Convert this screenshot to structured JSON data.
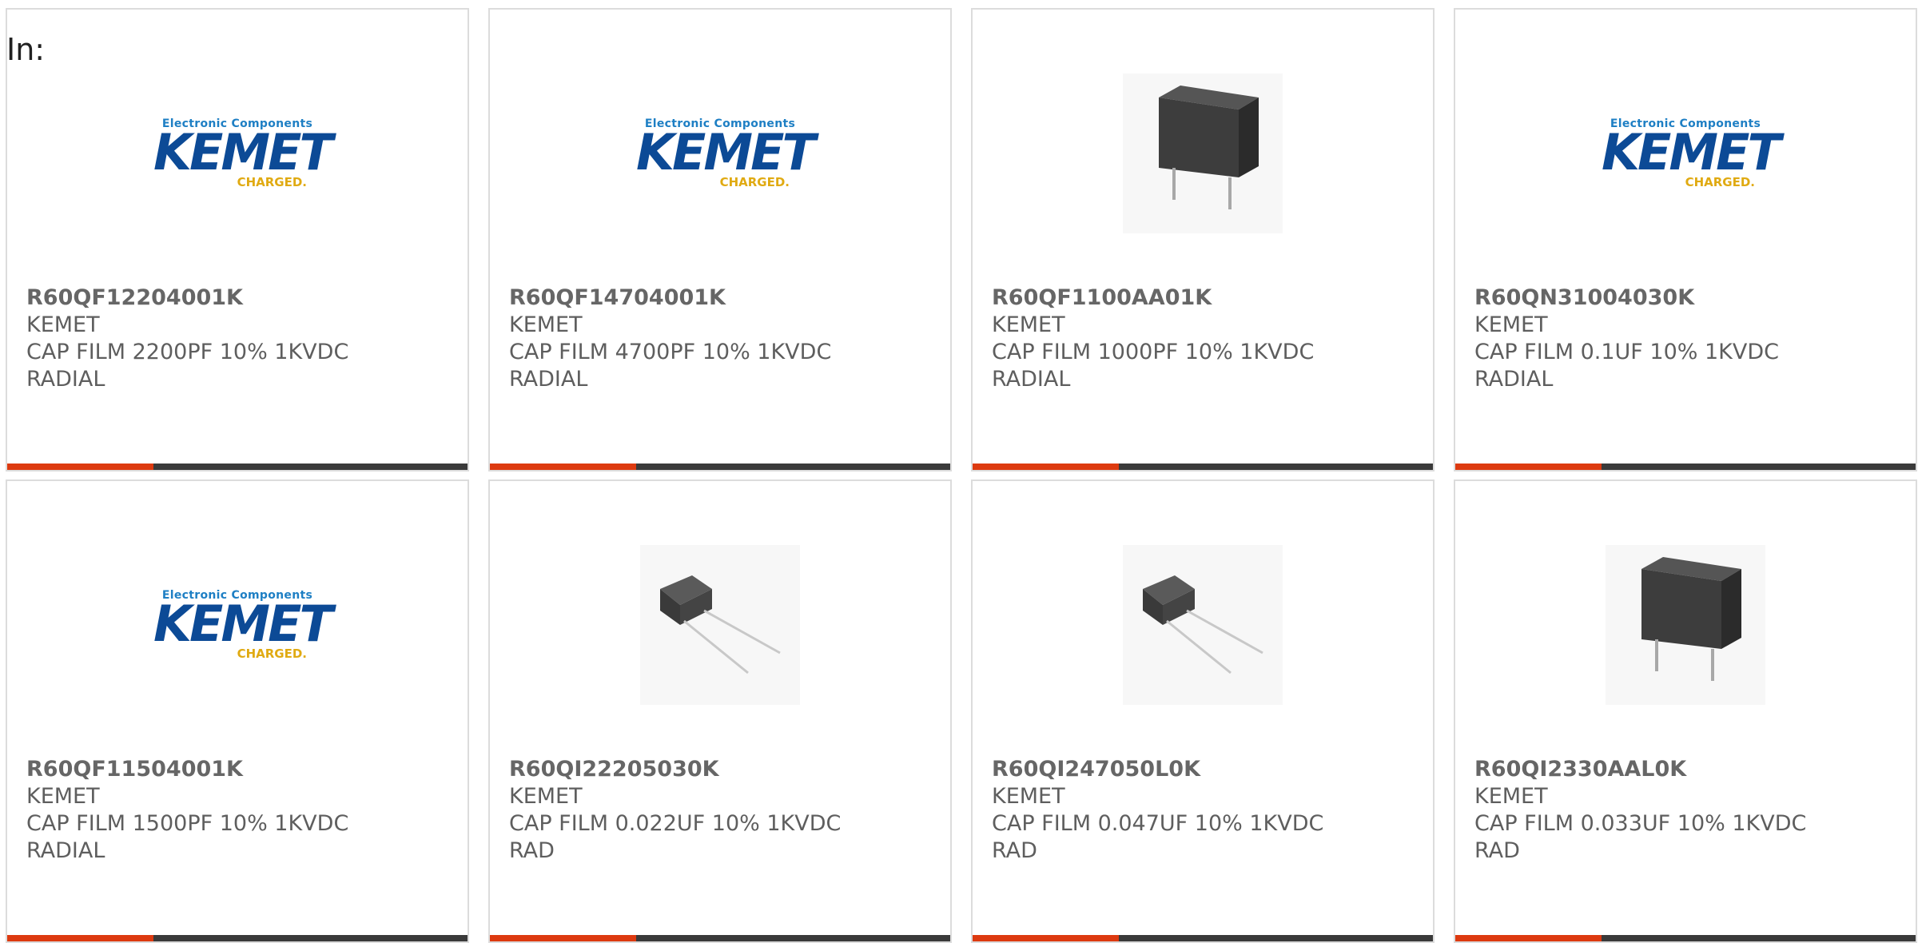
{
  "heading": "In:",
  "products": [
    {
      "pn": "R60QF12204001K",
      "brand": "KEMET",
      "desc1": "CAP FILM 2200PF 10% 1KVDC",
      "desc2": "RADIAL",
      "image": "kemet-logo"
    },
    {
      "pn": "R60QF14704001K",
      "brand": "KEMET",
      "desc1": "CAP FILM 4700PF 10% 1KVDC",
      "desc2": "RADIAL",
      "image": "kemet-logo"
    },
    {
      "pn": "R60QF1100AA01K",
      "brand": "KEMET",
      "desc1": "CAP FILM 1000PF 10% 1KVDC",
      "desc2": "RADIAL",
      "image": "upright-capacitor"
    },
    {
      "pn": "R60QN31004030K",
      "brand": "KEMET",
      "desc1": "CAP FILM 0.1UF 10% 1KVDC",
      "desc2": "RADIAL",
      "image": "kemet-logo"
    },
    {
      "pn": "R60QF11504001K",
      "brand": "KEMET",
      "desc1": "CAP FILM 1500PF 10% 1KVDC",
      "desc2": "RADIAL",
      "image": "kemet-logo"
    },
    {
      "pn": "R60QI22205030K",
      "brand": "KEMET",
      "desc1": "CAP FILM 0.022UF 10% 1KVDC",
      "desc2": "RAD",
      "image": "tilted-capacitor"
    },
    {
      "pn": "R60QI247050L0K",
      "brand": "KEMET",
      "desc1": "CAP FILM 0.047UF 10% 1KVDC",
      "desc2": "RAD",
      "image": "tilted-capacitor"
    },
    {
      "pn": "R60QI2330AAL0K",
      "brand": "KEMET",
      "desc1": "CAP FILM 0.033UF 10% 1KVDC",
      "desc2": "RAD",
      "image": "upright-capacitor"
    }
  ],
  "logo": {
    "top": "Electronic Components",
    "mid": "KEMET",
    "bot": "CHARGED."
  },
  "colors": {
    "accent": "#dd3a10",
    "bar": "#3a3a3a",
    "logo_blue": "#0c4a96",
    "logo_yellow": "#e0aa12"
  }
}
